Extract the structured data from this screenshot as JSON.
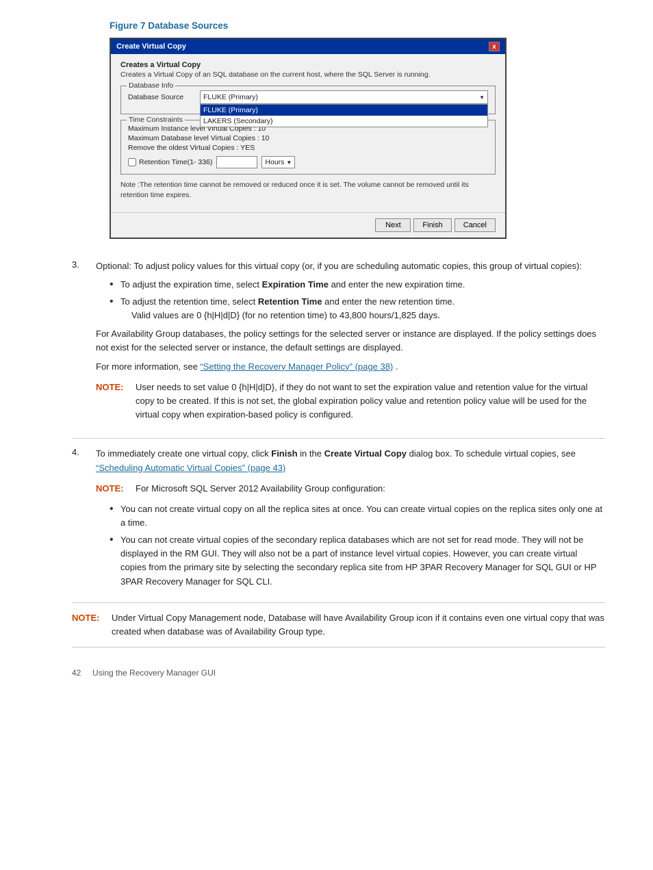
{
  "figure": {
    "title": "Figure 7  Database Sources"
  },
  "dialog": {
    "title": "Create Virtual Copy",
    "close_label": "x",
    "section_title": "Creates a Virtual Copy",
    "section_subtitle": "Creates a Virtual Copy of an SQL database on the current host, where the SQL Server is running.",
    "db_info_label": "Database Info",
    "db_source_label": "Database Source",
    "db_source_value": "FLUKE (Primary)",
    "dropdown_items": [
      {
        "label": "FLUKE (Primary)",
        "selected": true
      },
      {
        "label": "LAKERS (Secondary)",
        "selected": false
      }
    ],
    "time_constraints_label": "Time Constraints",
    "tc_line1": "Maximum Instance level Virtual Copies : 10",
    "tc_line2": "Maximum Database level Virtual Copies : 10",
    "tc_line3": "Remove the oldest Virtual Copies : YES",
    "retention_checkbox_label": "Retention Time(1- 336)",
    "retention_unit": "Hours",
    "note_text": "Note :The retention time cannot be removed or reduced once it is set. The volume cannot be removed until its retention time expires.",
    "btn_next": "Next",
    "btn_finish": "Finish",
    "btn_cancel": "Cancel"
  },
  "steps": [
    {
      "number": "3.",
      "text": "Optional: To adjust policy values for this virtual copy (or, if you are scheduling automatic copies, this group of virtual copies):",
      "bullets": [
        {
          "text_plain": "To adjust the expiration time, select ",
          "text_bold": "Expiration Time",
          "text_after": " and enter the new expiration time."
        },
        {
          "text_plain": "To adjust the retention time, select ",
          "text_bold": "Retention Time",
          "text_after": " and enter the new retention time.",
          "sub": "Valid values are 0 {h|H|d|D} (for no retention time) to 43,800 hours/1,825 days."
        }
      ],
      "para1": "For Availability Group databases, the policy settings for the selected server or instance are displayed. If the policy settings does not exist for the selected server or instance, the default settings are displayed.",
      "para2": "For more information, see ",
      "para2_link": "“Setting the Recovery Manager Policy” (page 38)",
      "para2_after": ".",
      "note_label": "NOTE:",
      "note_text": "User needs to set value 0 {h|H|d|D}, if they do not want to set the expiration value and retention value for the virtual copy to be created. If this is not set, the global expiration policy value and retention policy value will be used for the virtual copy when expiration-based policy is configured."
    },
    {
      "number": "4.",
      "text_plain": "To immediately create one virtual copy, click ",
      "text_bold1": "Finish",
      "text_middle": " in the ",
      "text_bold2": "Create Virtual Copy",
      "text_after": " dialog box. To schedule virtual copies, see ",
      "text_link": "“Scheduling Automatic Virtual Copies” (page 43)",
      "note_label": "NOTE:",
      "note_text": "For Microsoft SQL Server 2012 Availability Group configuration:",
      "bullets": [
        {
          "text": "You can not create virtual copy on all the replica sites at once. You can create virtual copies on the replica sites only one at a time."
        },
        {
          "text": "You can not create virtual copies of the secondary replica databases which are not set for read mode. They will not be displayed in the RM GUI. They will also not be a part of instance level virtual copies. However, you can create virtual copies from the primary site by selecting the secondary replica site from HP 3PAR Recovery Manager for SQL GUI or HP 3PAR Recovery Manager for SQL CLI."
        }
      ]
    }
  ],
  "final_note": {
    "label": "NOTE:",
    "text": "Under Virtual Copy Management node, Database will have Availability Group icon if it contains even one virtual copy that was created when database was of Availability Group type."
  },
  "footer": {
    "page_num": "42",
    "page_label": "Using the Recovery Manager GUI"
  }
}
